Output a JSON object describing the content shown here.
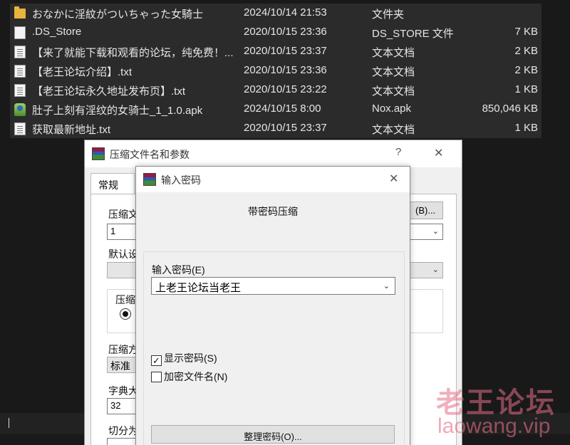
{
  "files": [
    {
      "icon": "folder-icon",
      "name": "おなかに淫紋がついちゃった女騎士",
      "date": "2024/10/14 21:53",
      "type": "文件夹",
      "size": ""
    },
    {
      "icon": "blank-file-icon",
      "name": ".DS_Store",
      "date": "2020/10/15 23:36",
      "type": "DS_STORE 文件",
      "size": "7 KB"
    },
    {
      "icon": "text-file-icon",
      "name": "【来了就能下载和观看的论坛，纯免费！...",
      "date": "2020/10/15 23:37",
      "type": "文本文档",
      "size": "2 KB"
    },
    {
      "icon": "text-file-icon",
      "name": "【老王论坛介绍】.txt",
      "date": "2020/10/15 23:36",
      "type": "文本文档",
      "size": "2 KB"
    },
    {
      "icon": "text-file-icon",
      "name": "【老王论坛永久地址发布页】.txt",
      "date": "2020/10/15 23:22",
      "type": "文本文档",
      "size": "1 KB"
    },
    {
      "icon": "apk-file-icon",
      "name": "肚子上刻有淫纹的女骑士_1_1.0.apk",
      "date": "2024/10/15 8:00",
      "type": "Nox.apk",
      "size": "850,046 KB"
    },
    {
      "icon": "text-file-icon",
      "name": "获取最新地址.txt",
      "date": "2020/10/15 23:37",
      "type": "文本文档",
      "size": "1 KB"
    }
  ],
  "archive_dialog": {
    "title": "压缩文件名和参数",
    "help_glyph": "?",
    "close_glyph": "✕",
    "tab_general": "常规",
    "archive_name_label": "压缩文",
    "archive_name_value": "1",
    "browse_button": "(B)...",
    "default_profile_label": "默认设",
    "format_group_label": "压缩",
    "method_label": "压缩方",
    "method_value": "标准",
    "dict_label": "字典大",
    "dict_value": "32",
    "split_label": "切分为",
    "partial_option": ")"
  },
  "password_dialog": {
    "title": "输入密码",
    "close_glyph": "✕",
    "heading": "带密码压缩",
    "password_label": "输入密码(E)",
    "password_value": "上老王论坛当老王",
    "show_password": {
      "label": "显示密码(S)",
      "checked": true
    },
    "encrypt_names": {
      "label": "加密文件名(N)",
      "checked": false
    },
    "organize_button": "整理密码(O)..."
  },
  "watermark": {
    "text_cn": "老王论坛",
    "text_url": "laowang.vip"
  }
}
